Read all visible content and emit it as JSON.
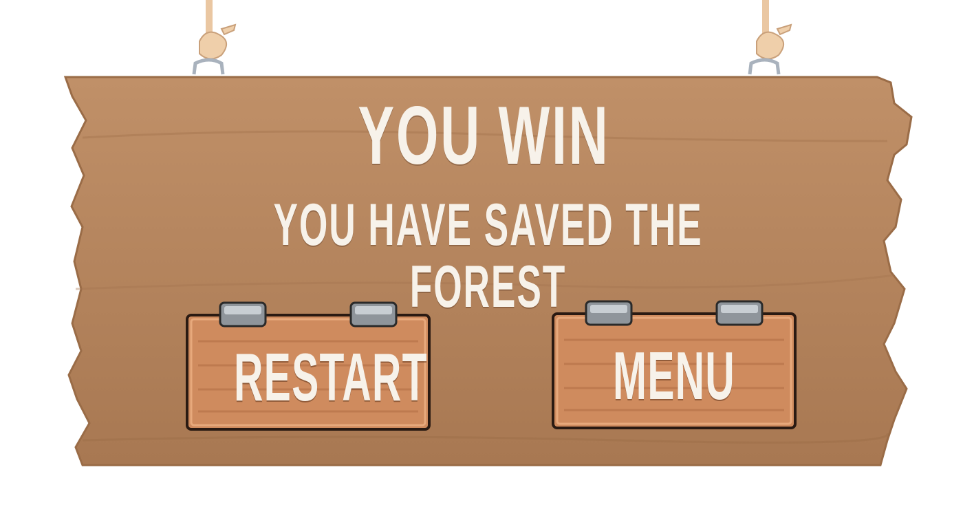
{
  "screen": {
    "title": "You win",
    "subtitle": "You have saved the forest"
  },
  "buttons": {
    "restart_label": "Restart",
    "menu_label": "Menu"
  },
  "colors": {
    "background": "#ffffff",
    "sign_wood": "#b6875f",
    "button_wood": "#cf8b5e",
    "text": "#f7f2ea",
    "rope": "#e8c19a",
    "hook": "#a9b2bd"
  },
  "icons": [
    "rope-left-icon",
    "rope-right-icon",
    "clip-icon"
  ]
}
